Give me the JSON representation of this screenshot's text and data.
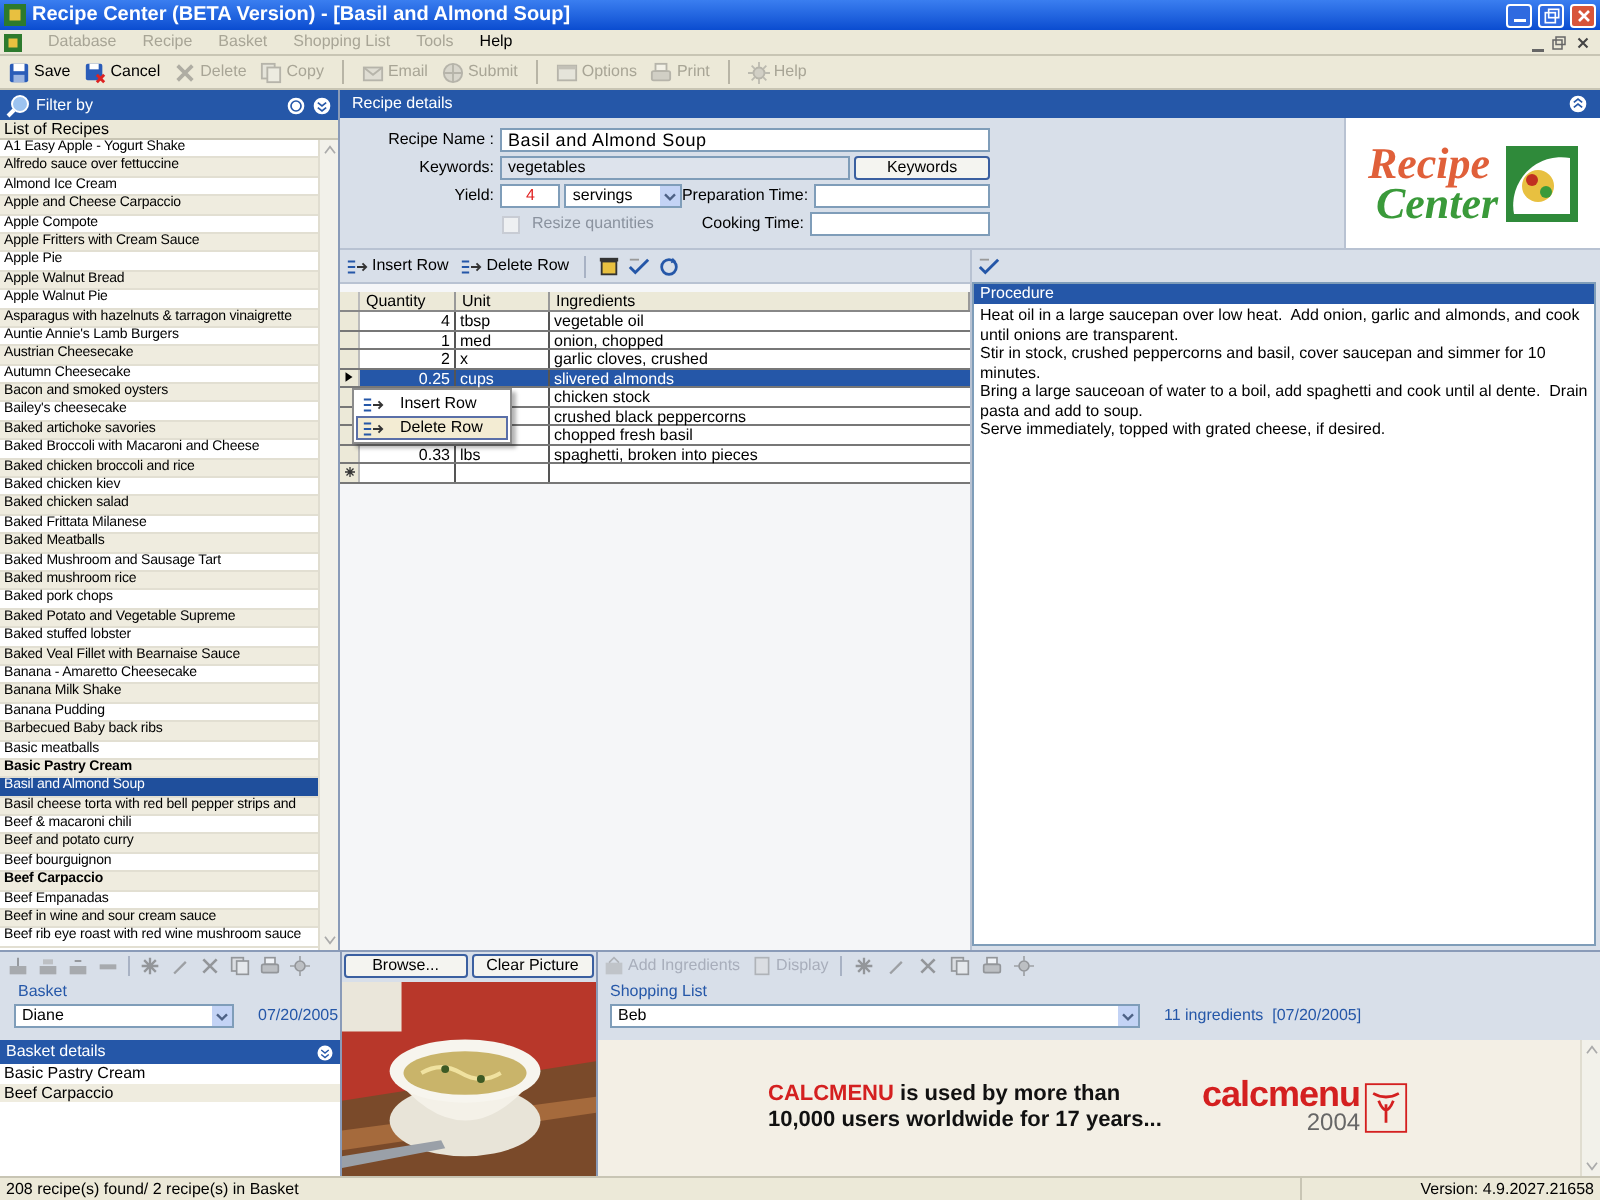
{
  "window": {
    "title": "Recipe Center (BETA Version) - [Basil and Almond Soup]"
  },
  "menu": [
    {
      "label": "Database",
      "disabled": true
    },
    {
      "label": "Recipe",
      "disabled": true
    },
    {
      "label": "Basket",
      "disabled": true
    },
    {
      "label": "Shopping List",
      "disabled": true
    },
    {
      "label": "Tools",
      "disabled": true
    },
    {
      "label": "Help",
      "disabled": false
    }
  ],
  "toolbar": [
    {
      "kind": "save",
      "label": "Save",
      "disabled": false
    },
    {
      "kind": "cancel",
      "label": "Cancel",
      "disabled": false
    },
    {
      "kind": "delete",
      "label": "Delete",
      "disabled": true
    },
    {
      "kind": "copy",
      "label": "Copy",
      "disabled": true
    },
    {
      "kind": "email",
      "label": "Email",
      "disabled": true
    },
    {
      "kind": "submit",
      "label": "Submit",
      "disabled": true
    },
    {
      "kind": "options",
      "label": "Options",
      "disabled": true
    },
    {
      "kind": "print",
      "label": "Print",
      "disabled": true
    },
    {
      "kind": "help",
      "label": "Help",
      "disabled": true
    }
  ],
  "filter_panel": {
    "title": "Filter by"
  },
  "recipe_list": {
    "header": "List of Recipes",
    "items": [
      {
        "label": "A1 Easy Apple - Yogurt Shake",
        "bold": false,
        "selected": false
      },
      {
        "label": "Alfredo sauce over fettuccine",
        "bold": false,
        "selected": false
      },
      {
        "label": "Almond Ice Cream",
        "bold": false,
        "selected": false
      },
      {
        "label": "Apple and Cheese Carpaccio",
        "bold": false,
        "selected": false
      },
      {
        "label": "Apple Compote",
        "bold": false,
        "selected": false
      },
      {
        "label": "Apple Fritters with Cream Sauce",
        "bold": false,
        "selected": false
      },
      {
        "label": "Apple Pie",
        "bold": false,
        "selected": false
      },
      {
        "label": "Apple Walnut Bread",
        "bold": false,
        "selected": false
      },
      {
        "label": "Apple Walnut Pie",
        "bold": false,
        "selected": false
      },
      {
        "label": "Asparagus with hazelnuts & tarragon vinaigrette",
        "bold": false,
        "selected": false
      },
      {
        "label": "Auntie Annie's Lamb Burgers",
        "bold": false,
        "selected": false
      },
      {
        "label": "Austrian Cheesecake",
        "bold": false,
        "selected": false
      },
      {
        "label": "Autumn Cheesecake",
        "bold": false,
        "selected": false
      },
      {
        "label": "Bacon and smoked oysters",
        "bold": false,
        "selected": false
      },
      {
        "label": "Bailey's cheesecake",
        "bold": false,
        "selected": false
      },
      {
        "label": "Baked artichoke savories",
        "bold": false,
        "selected": false
      },
      {
        "label": "Baked Broccoli with Macaroni and Cheese",
        "bold": false,
        "selected": false
      },
      {
        "label": "Baked chicken broccoli and rice",
        "bold": false,
        "selected": false
      },
      {
        "label": "Baked chicken kiev",
        "bold": false,
        "selected": false
      },
      {
        "label": "Baked chicken salad",
        "bold": false,
        "selected": false
      },
      {
        "label": "Baked Frittata Milanese",
        "bold": false,
        "selected": false
      },
      {
        "label": "Baked Meatballs",
        "bold": false,
        "selected": false
      },
      {
        "label": "Baked Mushroom and Sausage Tart",
        "bold": false,
        "selected": false
      },
      {
        "label": "Baked mushroom rice",
        "bold": false,
        "selected": false
      },
      {
        "label": "Baked pork chops",
        "bold": false,
        "selected": false
      },
      {
        "label": "Baked Potato and Vegetable Supreme",
        "bold": false,
        "selected": false
      },
      {
        "label": "Baked stuffed lobster",
        "bold": false,
        "selected": false
      },
      {
        "label": "Baked Veal Fillet with Bearnaise Sauce",
        "bold": false,
        "selected": false
      },
      {
        "label": "Banana - Amaretto Cheesecake",
        "bold": false,
        "selected": false
      },
      {
        "label": "Banana Milk Shake",
        "bold": false,
        "selected": false
      },
      {
        "label": "Banana Pudding",
        "bold": false,
        "selected": false
      },
      {
        "label": "Barbecued Baby back ribs",
        "bold": false,
        "selected": false
      },
      {
        "label": "Basic meatballs",
        "bold": false,
        "selected": false
      },
      {
        "label": "Basic Pastry Cream",
        "bold": true,
        "selected": false
      },
      {
        "label": "Basil and Almond Soup",
        "bold": false,
        "selected": true
      },
      {
        "label": "Basil cheese torta with red bell pepper strips and",
        "bold": false,
        "selected": false
      },
      {
        "label": "Beef & macaroni chili",
        "bold": false,
        "selected": false
      },
      {
        "label": "Beef and potato curry",
        "bold": false,
        "selected": false
      },
      {
        "label": "Beef bourguignon",
        "bold": false,
        "selected": false
      },
      {
        "label": "Beef Carpaccio",
        "bold": true,
        "selected": false
      },
      {
        "label": "Beef Empanadas",
        "bold": false,
        "selected": false
      },
      {
        "label": "Beef in wine and sour cream sauce",
        "bold": false,
        "selected": false
      },
      {
        "label": "Beef rib eye roast with red wine mushroom sauce",
        "bold": false,
        "selected": false
      }
    ]
  },
  "recipe_details": {
    "title": "Recipe details",
    "name_label": "Recipe Name :",
    "name": "Basil and Almond Soup",
    "keywords_label": "Keywords:",
    "keywords": "vegetables",
    "keywords_button": "Keywords",
    "yield_label": "Yield:",
    "yield": "4",
    "yield_unit": "servings",
    "resize": {
      "label": "Resize quantities",
      "checked": false,
      "disabled": true
    },
    "prep_label": "Preparation Time:",
    "cook_label": "Cooking Time:"
  },
  "logo": {
    "line1": "Recipe",
    "line2": "Center"
  },
  "grid_toolbar": [
    {
      "label": "Insert Row"
    },
    {
      "label": "Delete Row"
    }
  ],
  "ingredients": {
    "columns": [
      "Quantity",
      "Unit",
      "Ingredients"
    ],
    "rows": [
      {
        "quantity": "4",
        "unit": "tbsp",
        "ingredient": "vegetable oil",
        "selected": false
      },
      {
        "quantity": "1",
        "unit": "med",
        "ingredient": "onion, chopped",
        "selected": false
      },
      {
        "quantity": "2",
        "unit": "x",
        "ingredient": "garlic cloves, crushed",
        "selected": false
      },
      {
        "quantity": "0.25",
        "unit": "cups",
        "ingredient": "slivered almonds",
        "selected": true
      },
      {
        "ingredient": "chicken stock",
        "selected": false
      },
      {
        "ingredient": "crushed black peppercorns",
        "selected": false
      },
      {
        "ingredient": "chopped fresh basil",
        "selected": false
      },
      {
        "quantity": "0.33",
        "unit": "lbs",
        "ingredient": "spaghetti, broken into pieces",
        "selected": false
      }
    ]
  },
  "context_menu": [
    {
      "label": "Insert Row",
      "selected": false
    },
    {
      "label": "Delete Row",
      "selected": true
    }
  ],
  "procedure": {
    "title": "Procedure",
    "paragraphs": [
      "Heat oil in a large saucepan over low heat.  Add onion, garlic and almonds, and cook until onions are transparent.",
      "Stir in stock, crushed peppercorns and basil, cover saucepan and simmer for 10 minutes.",
      "Bring a large sauceoan of water to a boil, add spaghetti and cook until al dente.  Drain pasta and add to soup.",
      "Serve immediately, topped with grated cheese, if desired."
    ]
  },
  "basket": {
    "label": "Basket",
    "person": "Diane",
    "date": "07/20/2005",
    "details_title": "Basket details",
    "items": [
      "Basic Pastry Cream",
      "Beef Carpaccio"
    ]
  },
  "picture_buttons": [
    "Browse...",
    "Clear Picture"
  ],
  "shopping": {
    "toolbar": [
      {
        "label": "Add Ingredients",
        "disabled": true
      },
      {
        "label": "Display",
        "disabled": true
      }
    ],
    "label": "Shopping List",
    "list": "Beb",
    "summary": "11 ingredients  [07/20/2005]"
  },
  "ad": {
    "brand": "CALCMENU",
    "text": "is used by more than 10,000 users worldwide for 17 years...",
    "logo": "calcmenu",
    "logo_year": "2004"
  },
  "status_bar": {
    "left": "208 recipe(s) found/ 2 recipe(s) in Basket",
    "right": "Version: 4.9.2027.21658"
  }
}
